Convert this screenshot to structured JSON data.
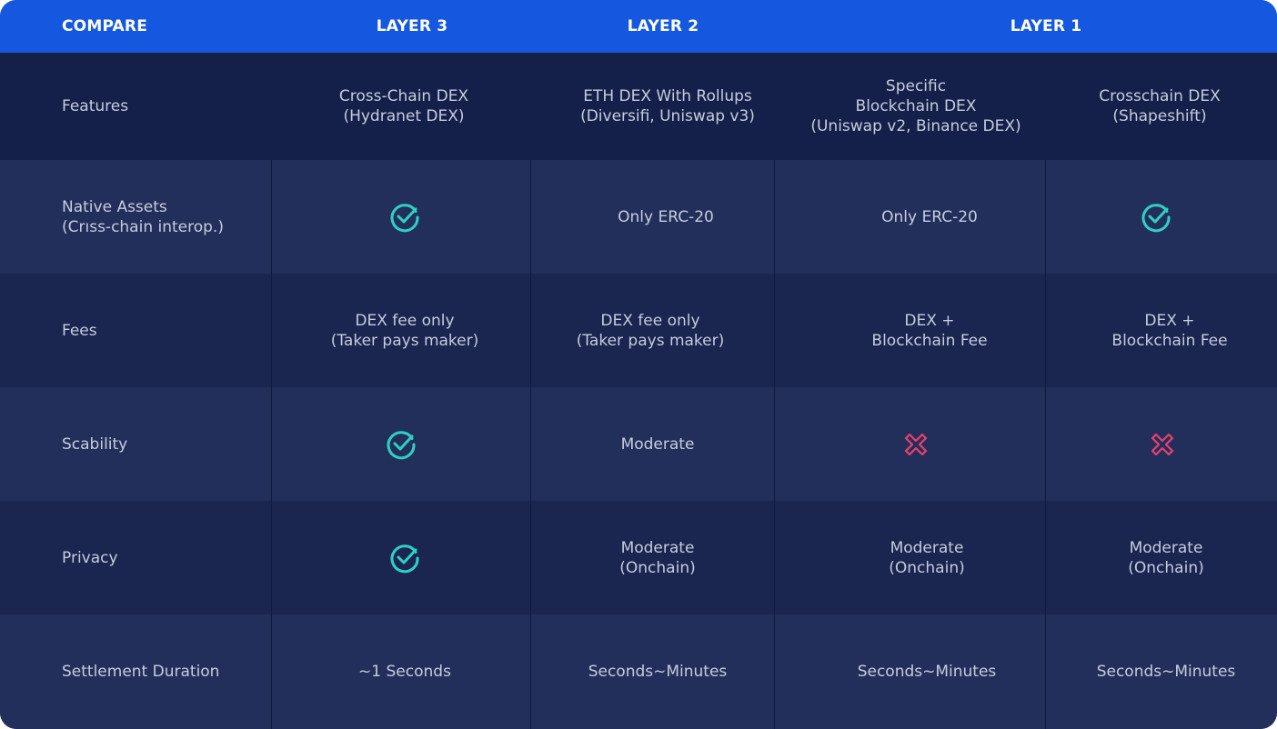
{
  "header": {
    "compare": "COMPARE",
    "layer3": "LAYER 3",
    "layer2": "LAYER 2",
    "layer1": "LAYER 1"
  },
  "rows": {
    "features": {
      "label": "Features",
      "c1": "Cross-Chain DEX\n(Hydranet DEX)",
      "c2": "ETH DEX With Rollups\n(Diversifi, Uniswap v3)",
      "c3": "Specific\nBlockchain DEX\n(Uniswap v2, Binance DEX)",
      "c4": "Crosschain DEX\n(Shapeshift)"
    },
    "native_assets": {
      "label": "Native Assets\n(Crıss-chain interop.)",
      "c1_icon": "check-circle-icon",
      "c2": "Only ERC-20",
      "c3": "Only ERC-20",
      "c4_icon": "check-circle-icon"
    },
    "fees": {
      "label": "Fees",
      "c1": "DEX fee only\n(Taker pays maker)",
      "c2": "DEX fee only\n(Taker pays maker)",
      "c3": "DEX +\nBlockchain Fee",
      "c4": "DEX +\nBlockchain Fee"
    },
    "scalability": {
      "label": "Scability",
      "c1_icon": "check-circle-icon",
      "c2": "Moderate",
      "c3_icon": "x-cross-icon",
      "c4_icon": "x-cross-icon"
    },
    "privacy": {
      "label": "Privacy",
      "c1_icon": "check-circle-icon",
      "c2": "Moderate\n(Onchain)",
      "c3": "Moderate\n(Onchain)",
      "c4": "Moderate\n(Onchain)"
    },
    "settlement": {
      "label": "Settlement Duration",
      "c1": "~1 Seconds",
      "c2": "Seconds~Minutes",
      "c3": "Seconds~Minutes",
      "c4": "Seconds~Minutes"
    }
  },
  "colors": {
    "header_bg": "#1558df",
    "check": "#2fd0c4",
    "cross": "#e8416b",
    "text": "#c5ccdd"
  }
}
